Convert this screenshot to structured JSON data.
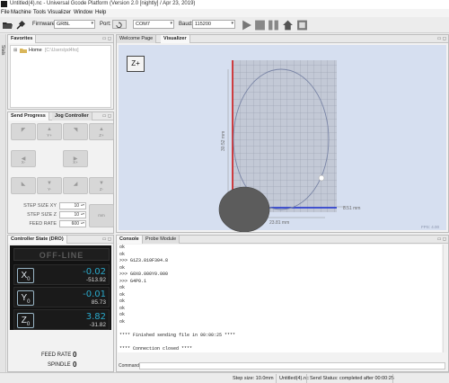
{
  "window": {
    "title": "Untitled(4).nc - Universal Gcode Platform (Version 2.0 [nightly] / Apr 23, 2019)"
  },
  "menu": [
    "File",
    "Machine",
    "Tools",
    "Visualizer",
    "Window",
    "Help"
  ],
  "toolbar": {
    "firmware_label": "Firmware:",
    "firmware_value": "GRBL",
    "port_label": "Port:",
    "port_value": "COM7",
    "baud_label": "Baud:",
    "baud_value": "115200"
  },
  "side_strip": {
    "label": "Stats"
  },
  "favorites": {
    "tab": "Favorites",
    "tree_item": "Home",
    "tree_path": "[C:\\Users\\pd4ho]"
  },
  "jog": {
    "tab_send": "Send Progress",
    "tab_jog": "Jog Controller",
    "buttons": {
      "y_plus": "Y+",
      "z_plus": "Z+",
      "x_minus": "X-",
      "x_plus": "X+",
      "y_minus": "Y-",
      "z_minus": "Z-"
    },
    "step_xy_label": "STEP SIZE XY",
    "step_xy_value": "10",
    "step_z_label": "STEP SIZE Z",
    "step_z_value": "10",
    "feed_label": "FEED RATE",
    "feed_value": "600",
    "unit_button": "mm"
  },
  "visualizer": {
    "tab_welcome": "Welcome Page",
    "tab_viz": "Visualizer",
    "view_button": "Z+",
    "dim_height": "30.52 mm",
    "dim_width": "23.81 mm",
    "dim_right": "8.51 mm",
    "fps": "FPS: 4.00"
  },
  "dro": {
    "tab": "Controller State (DRO)",
    "state": "OFF-LINE",
    "axes": [
      {
        "axis": "X",
        "work": "-0.02",
        "machine": "-513.92"
      },
      {
        "axis": "Y",
        "work": "-0.01",
        "machine": "85.73"
      },
      {
        "axis": "Z",
        "work": "3.82",
        "machine": "-31.82"
      }
    ],
    "feed_label": "FEED RATE",
    "feed_value": "0",
    "spindle_label": "SPINDLE",
    "spindle_value": "0"
  },
  "console": {
    "tab_console": "Console",
    "tab_probe": "Probe Module",
    "lines": [
      "ok",
      "ok",
      ">>> G1Z3.810F304.8",
      "ok",
      ">>> G0X0.000Y0.000",
      ">>> G4P0.1",
      "ok",
      "ok",
      "ok",
      "ok",
      "ok",
      "ok",
      "",
      "**** Finished sending file in 00:00:25 ****",
      "",
      "**** Connection closed ****"
    ],
    "command_label": "Command:"
  },
  "status": {
    "step_size": "Step size: 10.0mm",
    "file": "Untitled(4).nc",
    "send_status": "Send Status: completed after 00:00:25"
  }
}
